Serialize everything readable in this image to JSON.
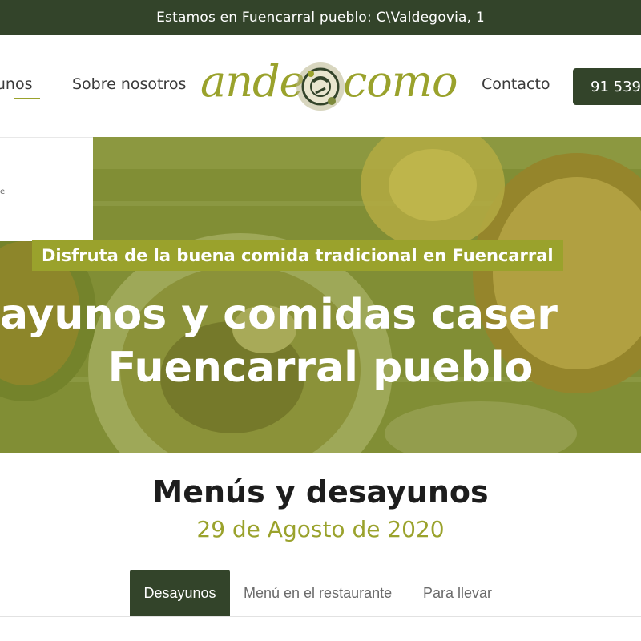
{
  "topbar": {
    "text": "Estamos en Fuencarral pueblo: C\\Valdegovia, 1"
  },
  "header": {
    "nav": {
      "desayunos": "ayunos",
      "sobre": "Sobre nosotros",
      "contacto": "Contacto"
    },
    "logo": {
      "word1": "ande",
      "word2": "como"
    },
    "phone": "91 539"
  },
  "dropdown": {
    "mark": "e"
  },
  "hero": {
    "badge": "Disfruta de la buena comida tradicional en Fuencarral",
    "title_line1": "ayunos y comidas caser",
    "title_line2": "Fuencarral pueblo"
  },
  "section": {
    "title": "Menús y desayunos",
    "date": "29 de Agosto de 2020"
  },
  "tabs": [
    {
      "label": "Desayunos",
      "active": true
    },
    {
      "label": "Menú en el restaurante",
      "active": false
    },
    {
      "label": "Para llevar",
      "active": false
    }
  ],
  "colors": {
    "dark_green": "#33442a",
    "olive": "#9aa22c",
    "hero_overlay": "#8a9a2a"
  }
}
